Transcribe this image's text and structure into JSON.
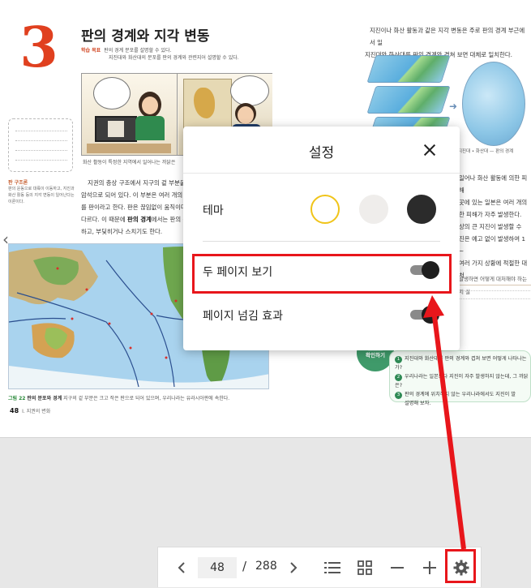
{
  "book": {
    "chapter_number": "3",
    "chapter_title": "판의 경계와 지각 변동",
    "goals_label": "학습 목표",
    "goal_1": "판의 경계 분포를 설명할 수 있다.",
    "goal_2": "지진대와 화산대의 분포를 판의 경계와 관련지어 설명할 수 있다.",
    "comic_caption": "화산 활동이 특정한 지역에서 일어나는 까닭은",
    "side_term": "판 구조론",
    "side_definition": "판의 운동으로 대륙이 이동하고, 지진과 화산 활동 등의 지각 변동이 일어난다는 이론이다.",
    "body_paragraph_1": "지권의 층상 구조에서 지구의 겉 부분을",
    "body_paragraph_2": "암석으로 되어 있다. 이 부분은 여러 개의",
    "body_paragraph_3": "를 판이라고 한다. 판은 끊임없이 움직이며",
    "body_paragraph_4": "다르다. 이 때문에",
    "body_paragraph_bold": "판의 경계",
    "body_paragraph_5": "에서는 판의 움",
    "body_paragraph_6": "하고, 부딪히거나 스치기도 한다.",
    "map_caption_label": "그림 22",
    "map_caption_title": "판의 분포와 경계",
    "map_caption_text": "지구의 겉 부분은 크고 작은 판으로 되어 있으며, 우리나라는 유라시아판에 속한다.",
    "page_number": "48",
    "section_name": "I. 지권의 변화",
    "right_intro_1": "지진이나 화산 활동과 같은 지각 변동은 주로 판의 경계 부근에서 일",
    "right_intro_2": "지진대와 화산대를 판의 경계와 겹쳐 보면 대체로 일치한다.",
    "globe_legend": "• 지진대  • 화산대  — 판의 경계",
    "right_body_1": "일어나 화산 활동에 의한 피해",
    "right_body_2": "곳에 있는 일본은 여러 개의",
    "right_body_3": "한 피해가 자주 발생한다.",
    "right_body_4": "상의 큰 지진이 발생할 수",
    "right_body_5": "진은 예고 없이 발생하여 1 ~",
    "right_body_6": "여러 가지 상황에 적절한 대처",
    "quiz_question": "발생하면 어떻게 대처해야 하는지 실",
    "check_label_1": "스스로",
    "check_label_2": "확인하기",
    "check_item_1": "지진대와 화산대를 판의 경계와 겹쳐 보면 어떻게 나타나는가?",
    "check_item_2": "우리나라는 일본보다 지진이 자주 발생하지 않는데, 그 까닭은?",
    "check_item_3": "판의 경계에 위치하지 않는 우리나라에서도 지진이 발",
    "check_item_4": "설명해 보자."
  },
  "settings_modal": {
    "title": "설정",
    "close_icon": "close-icon",
    "theme_label": "테마",
    "themes": [
      {
        "name": "light",
        "fill": "#ffffff",
        "border": "#f0c419",
        "selected": true
      },
      {
        "name": "sepia",
        "fill": "#efedeb",
        "border": "#efedeb",
        "selected": false
      },
      {
        "name": "dark",
        "fill": "#2b2b2b",
        "border": "#2b2b2b",
        "selected": false
      }
    ],
    "two_page_label": "두 페이지 보기",
    "two_page_on": true,
    "page_turn_label": "페이지 넘김 효과",
    "page_turn_on": true
  },
  "toolbar": {
    "prev_icon": "chevron-left-icon",
    "current_page": "48",
    "separator": "/",
    "total_pages": "288",
    "next_icon": "chevron-right-icon",
    "toc_icon": "list-icon",
    "grid_icon": "grid-icon",
    "zoom_out_icon": "minus-icon",
    "zoom_in_icon": "plus-icon",
    "settings_icon": "gear-icon"
  },
  "annotation": {
    "color": "#e8161b"
  }
}
